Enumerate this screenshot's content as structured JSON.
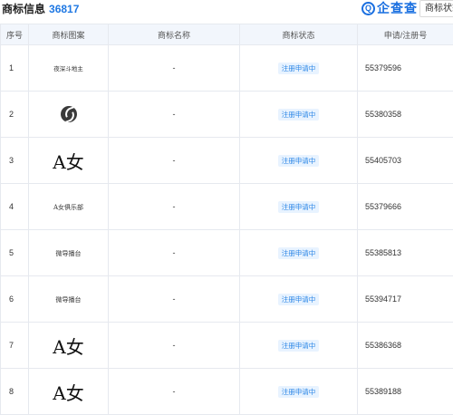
{
  "header": {
    "title": "商标信息",
    "count": "36817",
    "brand": "企查查",
    "brand_mark": "Q",
    "status_filter": "商标状态"
  },
  "table": {
    "columns": [
      "序号",
      "商标图案",
      "商标名称",
      "商标状态",
      "申请/注册号"
    ],
    "rows": [
      {
        "index": "1",
        "logo_text": "夜深斗地主",
        "logo_style": "small",
        "name": "-",
        "status": "注册申请中",
        "reg_no": "55379596"
      },
      {
        "index": "2",
        "logo_text": "",
        "logo_style": "s-icon",
        "name": "-",
        "status": "注册申请中",
        "reg_no": "55380358"
      },
      {
        "index": "3",
        "logo_text": "A女",
        "logo_style": "big",
        "name": "-",
        "status": "注册申请中",
        "reg_no": "55405703"
      },
      {
        "index": "4",
        "logo_text": "A女俱乐部",
        "logo_style": "mid",
        "name": "-",
        "status": "注册申请中",
        "reg_no": "55379666"
      },
      {
        "index": "5",
        "logo_text": "微导播台",
        "logo_style": "mid",
        "name": "-",
        "status": "注册申请中",
        "reg_no": "55385813"
      },
      {
        "index": "6",
        "logo_text": "微导播台",
        "logo_style": "mid",
        "name": "-",
        "status": "注册申请中",
        "reg_no": "55394717"
      },
      {
        "index": "7",
        "logo_text": "A女",
        "logo_style": "big",
        "name": "-",
        "status": "注册申请中",
        "reg_no": "55386368"
      },
      {
        "index": "8",
        "logo_text": "A女",
        "logo_style": "big",
        "name": "-",
        "status": "注册申请中",
        "reg_no": "55389188"
      }
    ]
  },
  "colors": {
    "accent": "#1f78e3",
    "badge_bg": "#e8f3ff",
    "badge_text": "#2b86e6",
    "header_bg": "#f2f6fc"
  }
}
